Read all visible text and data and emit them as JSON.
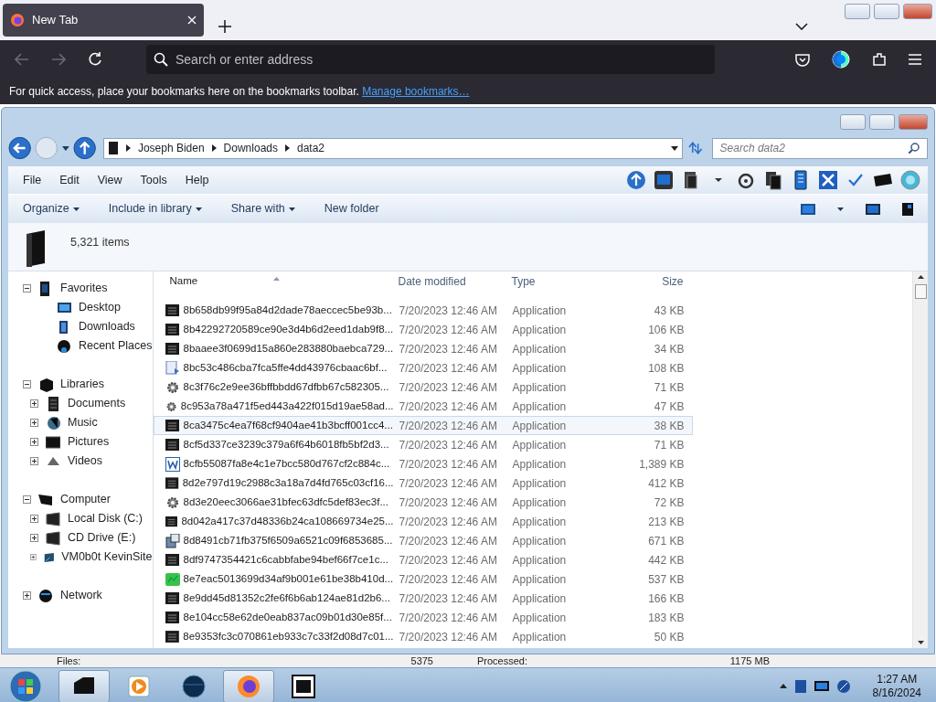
{
  "browser": {
    "tabs": [
      {
        "title": "New Tab",
        "selected": true
      }
    ],
    "address_placeholder": "Search or enter address",
    "bookmarks_hint": "For quick access, place your bookmarks here on the bookmarks toolbar.",
    "bookmarks_link": "Manage bookmarks…"
  },
  "explorer": {
    "breadcrumb": [
      "Joseph Biden",
      "Downloads",
      "data2"
    ],
    "search_placeholder": "Search data2",
    "menu": [
      "File",
      "Edit",
      "View",
      "Tools",
      "Help"
    ],
    "commands": [
      {
        "label": "Organize",
        "dropdown": true
      },
      {
        "label": "Include in library",
        "dropdown": true
      },
      {
        "label": "Share with",
        "dropdown": true
      },
      {
        "label": "New folder",
        "dropdown": false
      }
    ],
    "item_count": "5,321 items",
    "nav": [
      {
        "label": "Favorites",
        "kind": "favorites",
        "expanded": true,
        "children": [
          {
            "label": "Desktop",
            "kind": "desktop"
          },
          {
            "label": "Downloads",
            "kind": "downloads"
          },
          {
            "label": "Recent Places",
            "kind": "recent"
          }
        ]
      },
      {
        "label": "Libraries",
        "kind": "libraries",
        "expanded": true,
        "children": [
          {
            "label": "Documents",
            "kind": "documents",
            "expanded": false
          },
          {
            "label": "Music",
            "kind": "music",
            "expanded": false
          },
          {
            "label": "Pictures",
            "kind": "pictures",
            "expanded": false
          },
          {
            "label": "Videos",
            "kind": "videos",
            "expanded": false
          }
        ]
      },
      {
        "label": "Computer",
        "kind": "computer",
        "expanded": true,
        "children": [
          {
            "label": "Local Disk (C:)",
            "kind": "drive",
            "expanded": false
          },
          {
            "label": "CD Drive (E:)",
            "kind": "drive",
            "expanded": false
          },
          {
            "label": "VM0b0t KevinSite",
            "kind": "netdrive",
            "expanded": false
          }
        ]
      },
      {
        "label": "Network",
        "kind": "network",
        "expanded": false
      }
    ],
    "columns": [
      {
        "label": "Name",
        "sorted": true
      },
      {
        "label": "Date modified",
        "sorted": false
      },
      {
        "label": "Type",
        "sorted": false
      },
      {
        "label": "Size",
        "sorted": false
      }
    ],
    "rows": [
      {
        "name": "8b658db99f95a84d2dade78aeccec5be93b...",
        "date": "7/20/2023 12:46 AM",
        "type": "Application",
        "size": "43 KB",
        "kind": "exe",
        "selected": false
      },
      {
        "name": "8b42292720589ce90e3d4b6d2eed1dab9f8...",
        "date": "7/20/2023 12:46 AM",
        "type": "Application",
        "size": "106 KB",
        "kind": "exe",
        "selected": false
      },
      {
        "name": "8baaee3f0699d15a860e283880baebca729...",
        "date": "7/20/2023 12:46 AM",
        "type": "Application",
        "size": "34 KB",
        "kind": "exe",
        "selected": false
      },
      {
        "name": "8bc53c486cba7fca5ffe4dd43976cbaac6bf...",
        "date": "7/20/2023 12:46 AM",
        "type": "Application",
        "size": "108 KB",
        "kind": "page",
        "selected": false
      },
      {
        "name": "8c3f76c2e9ee36bffbbdd67dfbb67c582305...",
        "date": "7/20/2023 12:46 AM",
        "type": "Application",
        "size": "71 KB",
        "kind": "gear",
        "selected": false
      },
      {
        "name": "8c953a78a471f5ed443a422f015d19ae58ad...",
        "date": "7/20/2023 12:46 AM",
        "type": "Application",
        "size": "47 KB",
        "kind": "gear",
        "selected": false
      },
      {
        "name": "8ca3475c4ea7f68cf9404ae41b3bcff001cc4...",
        "date": "7/20/2023 12:46 AM",
        "type": "Application",
        "size": "38 KB",
        "kind": "exe",
        "selected": true
      },
      {
        "name": "8cf5d337ce3239c379a6f64b6018fb5bf2d3...",
        "date": "7/20/2023 12:46 AM",
        "type": "Application",
        "size": "71 KB",
        "kind": "exe",
        "selected": false
      },
      {
        "name": "8cfb55087fa8e4c1e7bcc580d767cf2c884c...",
        "date": "7/20/2023 12:46 AM",
        "type": "Application",
        "size": "1,389 KB",
        "kind": "doc",
        "selected": false
      },
      {
        "name": "8d2e797d19c2988c3a18a7d4fd765c03cf16...",
        "date": "7/20/2023 12:46 AM",
        "type": "Application",
        "size": "412 KB",
        "kind": "exe",
        "selected": false
      },
      {
        "name": "8d3e20eec3066ae31bfec63dfc5def83ec3f...",
        "date": "7/20/2023 12:46 AM",
        "type": "Application",
        "size": "72 KB",
        "kind": "gear",
        "selected": false
      },
      {
        "name": "8d042a417c37d48336b24ca108669734e25...",
        "date": "7/20/2023 12:46 AM",
        "type": "Application",
        "size": "213 KB",
        "kind": "exe",
        "selected": false
      },
      {
        "name": "8d8491cb71fb375f6509a6521c09f6853685...",
        "date": "7/20/2023 12:46 AM",
        "type": "Application",
        "size": "671 KB",
        "kind": "setup",
        "selected": false
      },
      {
        "name": "8df9747354421c6cabbfabe94bef66f7ce1c...",
        "date": "7/20/2023 12:46 AM",
        "type": "Application",
        "size": "442 KB",
        "kind": "exe",
        "selected": false
      },
      {
        "name": "8e7eac5013699d34af9b001e61be38b410d...",
        "date": "7/20/2023 12:46 AM",
        "type": "Application",
        "size": "537 KB",
        "kind": "chart",
        "selected": false
      },
      {
        "name": "8e9dd45d81352c2fe6f6b6ab124ae81d2b6...",
        "date": "7/20/2023 12:46 AM",
        "type": "Application",
        "size": "166 KB",
        "kind": "exe",
        "selected": false
      },
      {
        "name": "8e104cc58e62de0eab837ac09b01d30e85f...",
        "date": "7/20/2023 12:46 AM",
        "type": "Application",
        "size": "183 KB",
        "kind": "exe",
        "selected": false
      },
      {
        "name": "8e9353fc3c070861eb933c7c33f2d08d7c01...",
        "date": "7/20/2023 12:46 AM",
        "type": "Application",
        "size": "50 KB",
        "kind": "exe",
        "selected": false
      }
    ]
  },
  "status_bar": {
    "files_label": "Files:",
    "files": "5375",
    "processed_label": "Processed:",
    "processed": "1175 MB"
  },
  "taskbar": {
    "apps": [
      {
        "kind": "explorer",
        "active": true
      },
      {
        "kind": "media",
        "active": false
      },
      {
        "kind": "globe",
        "active": false
      },
      {
        "kind": "firefox",
        "active": true
      },
      {
        "kind": "archiver",
        "active": false
      }
    ],
    "time": "1:27 AM",
    "date": "8/16/2024"
  }
}
